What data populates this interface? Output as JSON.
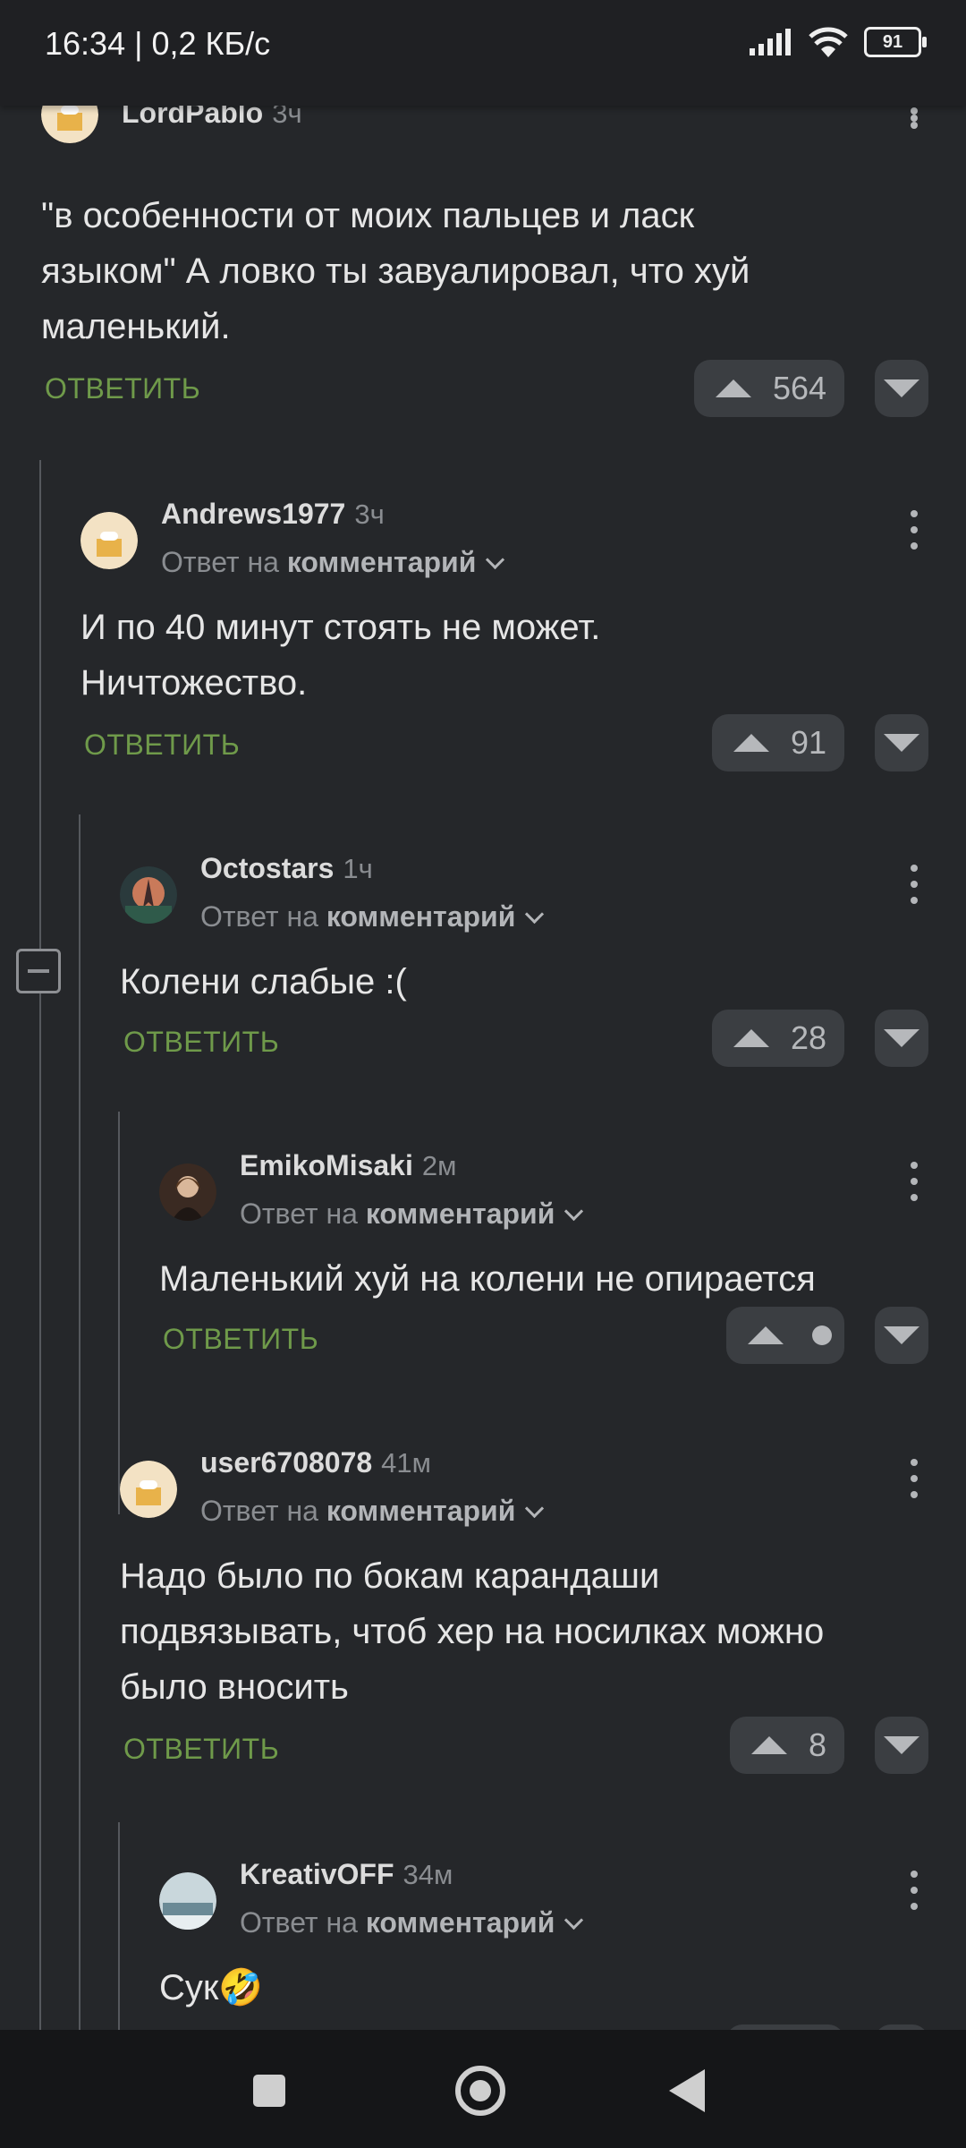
{
  "status_bar": {
    "time_speed": "16:34 | 0,2 КБ/с",
    "battery": "91"
  },
  "reply_to_prefix": "Ответ на",
  "reply_to_target": "комментарий",
  "reply_label": "ОТВЕТИТЬ",
  "comments": [
    {
      "user": "LordPablo",
      "time": "3ч",
      "lines": [
        "\"в особенности от моих пальцев и ласк",
        "языком\" А ловко ты завуалировал, что хуй",
        "маленький."
      ],
      "votes": "564"
    },
    {
      "user": "Andrews1977",
      "time": "3ч",
      "lines": [
        "И по 40 минут стоять не может.",
        "Ничтожество."
      ],
      "votes": "91"
    },
    {
      "user": "Octostars",
      "time": "1ч",
      "lines": [
        "Колени слабые :("
      ],
      "votes": "28"
    },
    {
      "user": "EmikoMisaki",
      "time": "2м",
      "lines": [
        "Маленький хуй на колени не опирается"
      ],
      "votes": ""
    },
    {
      "user": "user6708078",
      "time": "41м",
      "lines": [
        "Надо было по бокам карандаши",
        "подвязывать, чтоб хер на носилках можно",
        "было вносить"
      ],
      "votes": "8"
    },
    {
      "user": "KreativOFF",
      "time": "34м",
      "lines": [
        "Сук🤣"
      ],
      "votes": ""
    }
  ],
  "icons": {
    "signal": "signal-icon",
    "wifi": "wifi-icon",
    "battery": "battery-icon",
    "more": "more-vert-icon",
    "upvote": "upvote-icon",
    "downvote": "downvote-icon",
    "collapse": "collapse-thread-icon",
    "nav_recents": "recents-icon",
    "nav_home": "home-icon",
    "nav_back": "back-icon"
  },
  "colors": {
    "background": "#25272a",
    "reply_green": "#6f9a4a",
    "muted_text": "#8a8d91"
  }
}
